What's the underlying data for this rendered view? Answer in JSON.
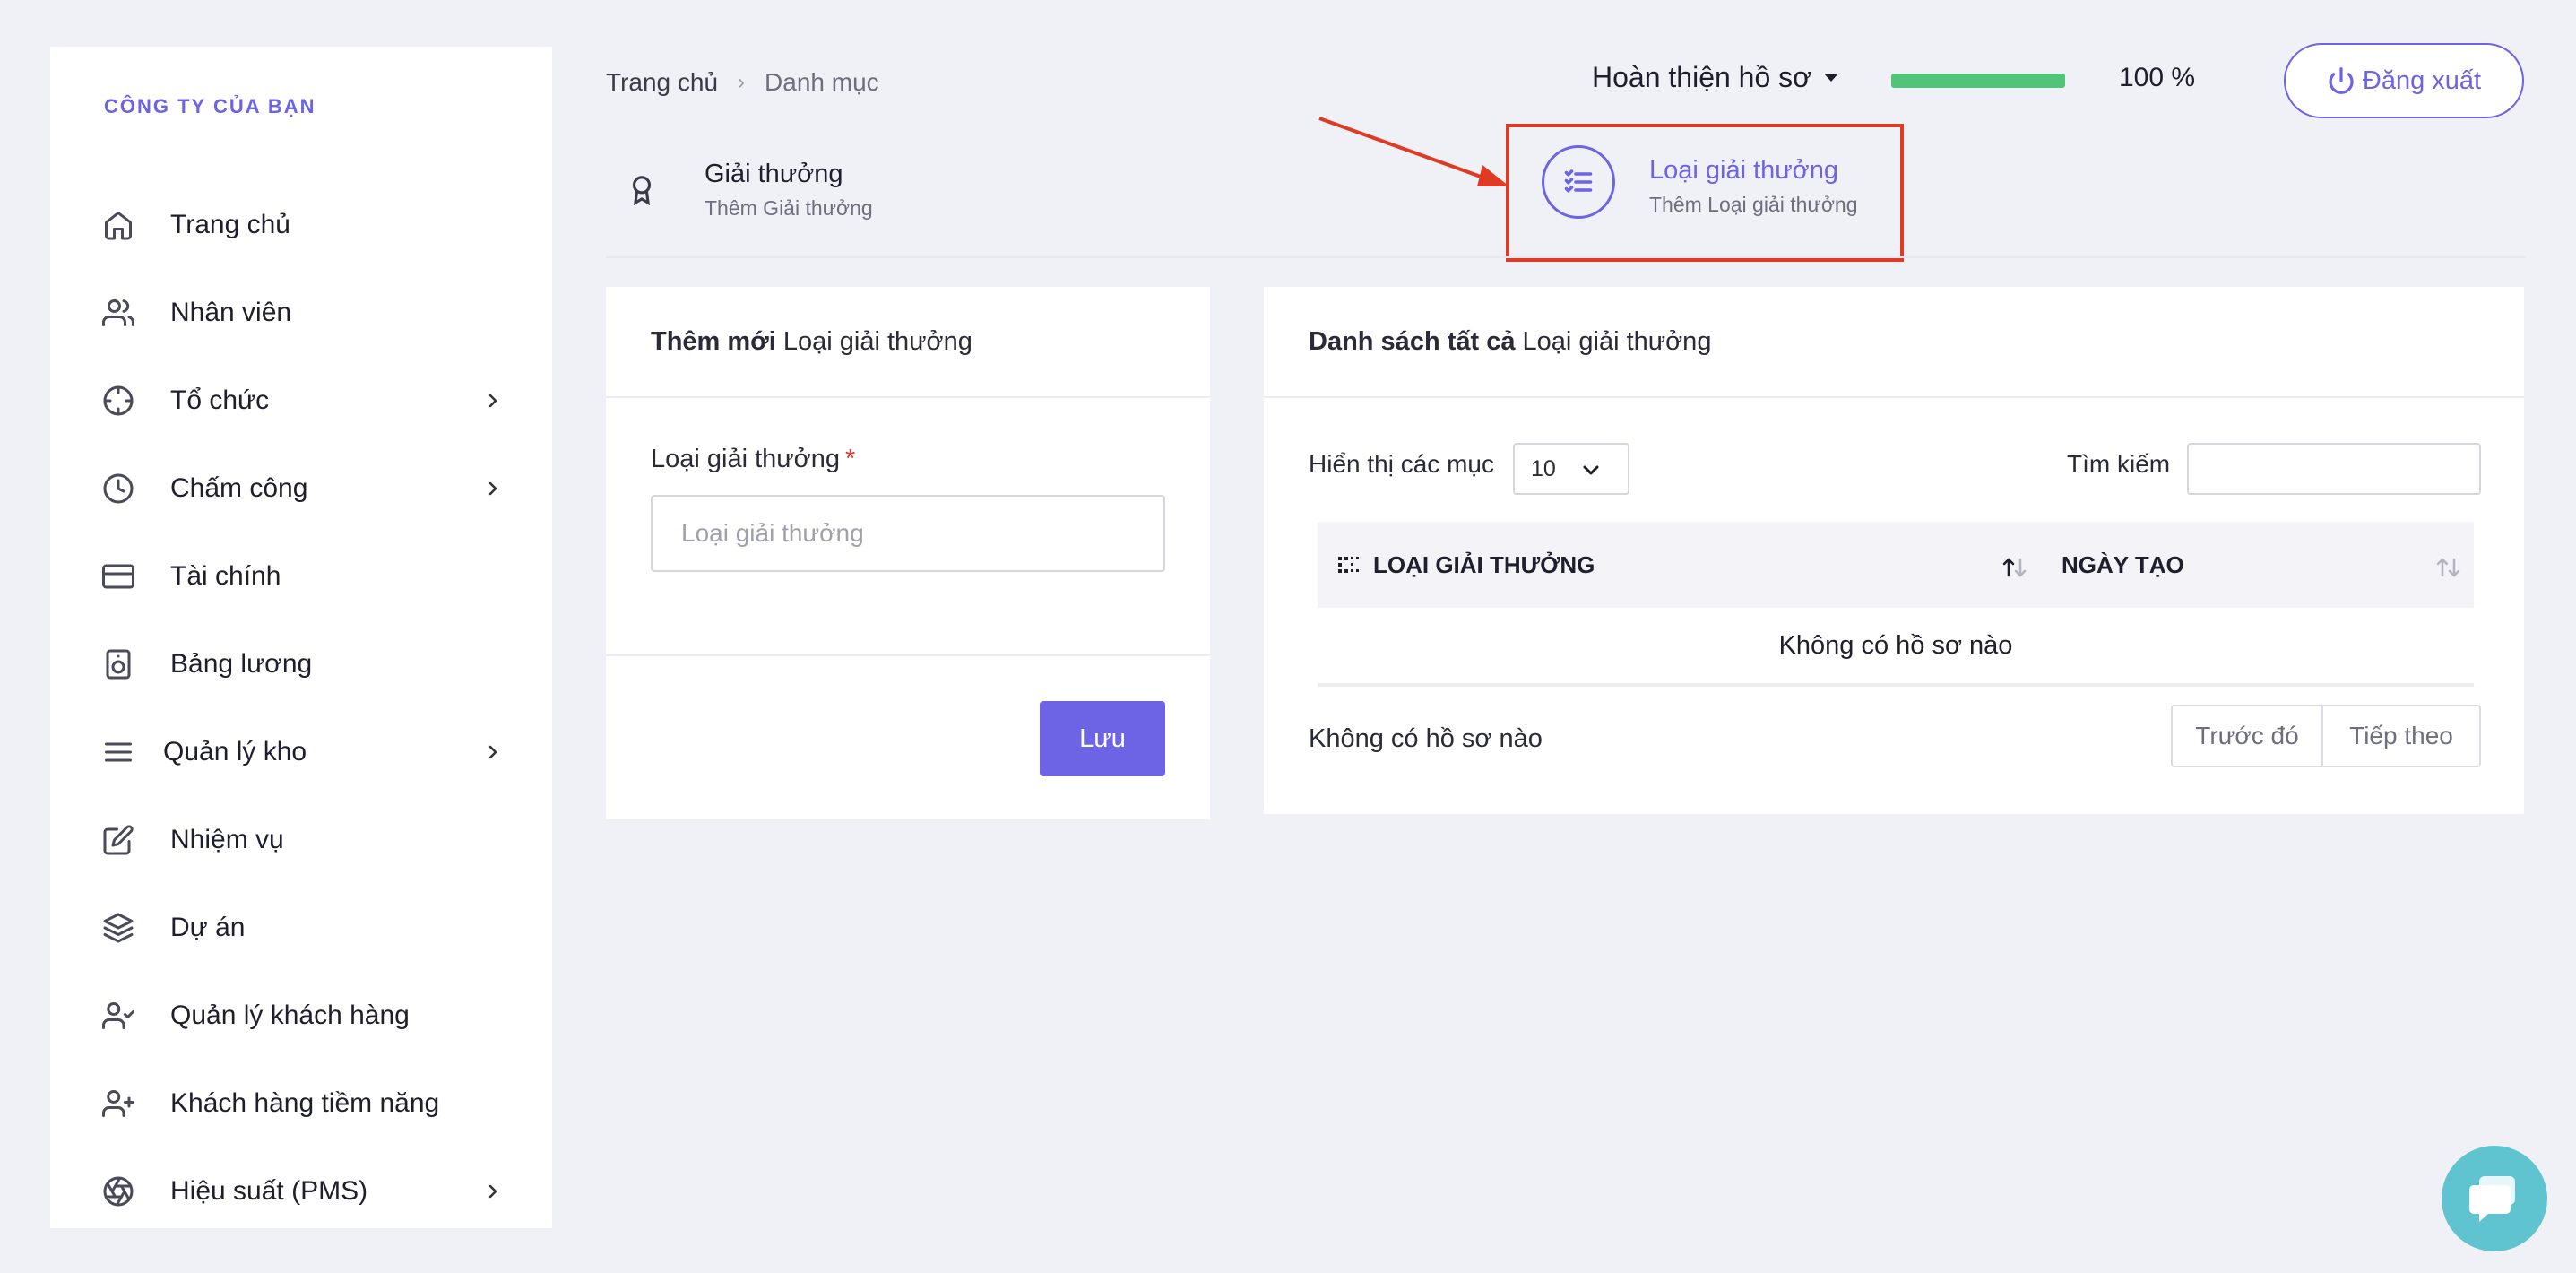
{
  "sidebar": {
    "company": "CÔNG TY CỦA BẠN",
    "items": [
      {
        "label": "Trang chủ",
        "icon": "home-icon"
      },
      {
        "label": "Nhân viên",
        "icon": "users-icon"
      },
      {
        "label": "Tổ chức",
        "icon": "crosshair-icon",
        "has_children": true
      },
      {
        "label": "Chấm công",
        "icon": "clock-icon",
        "has_children": true
      },
      {
        "label": "Tài chính",
        "icon": "credit-card-icon"
      },
      {
        "label": "Bảng lương",
        "icon": "speaker-icon"
      },
      {
        "label": "Quản lý kho",
        "icon": "menu-icon",
        "has_children": true
      },
      {
        "label": "Nhiệm vụ",
        "icon": "edit-icon"
      },
      {
        "label": "Dự án",
        "icon": "layers-icon"
      },
      {
        "label": "Quản lý khách hàng",
        "icon": "user-check-icon"
      },
      {
        "label": "Khách hàng tiềm năng",
        "icon": "user-plus-icon"
      },
      {
        "label": "Hiệu suất (PMS)",
        "icon": "aperture-icon",
        "has_children": true
      }
    ]
  },
  "header": {
    "breadcrumb": {
      "home": "Trang chủ",
      "separator": "›",
      "current": "Danh mục"
    },
    "profile_dropdown": "Hoàn thiện hồ sơ",
    "profile_progress": 1.0,
    "profile_progress_text": "100 %",
    "logout_label": "Đăng xuất"
  },
  "tabs": [
    {
      "title": "Giải thưởng",
      "subtitle": "Thêm Giải thưởng",
      "icon": "award-icon"
    },
    {
      "title": "Loại giải thưởng",
      "subtitle": "Thêm Loại giải thưởng",
      "icon": "list-check-icon"
    }
  ],
  "form_card": {
    "heading_bold": "Thêm mới",
    "heading_rest": "Loại giải thưởng",
    "field_label": "Loại giải thưởng",
    "required_mark": "*",
    "field_placeholder": "Loại giải thưởng",
    "field_value": "",
    "save_label": "Lưu"
  },
  "list_card": {
    "heading_bold": "Danh sách tất cả",
    "heading_rest": "Loại giải thưởng",
    "length_label": "Hiển thị các mục",
    "length_value": "10",
    "search_label": "Tìm kiếm",
    "search_value": "",
    "columns": [
      "LOẠI GIẢI THƯỞNG",
      "NGÀY TẠO"
    ],
    "empty_message": "Không có hồ sơ nào",
    "info_text": "Không có hồ sơ nào",
    "prev_label": "Trước đó",
    "next_label": "Tiếp theo"
  },
  "colors": {
    "accent": "#6c63e5",
    "progress": "#52c47a",
    "highlight_box": "#e03a24",
    "chat": "#5fc4d0"
  }
}
